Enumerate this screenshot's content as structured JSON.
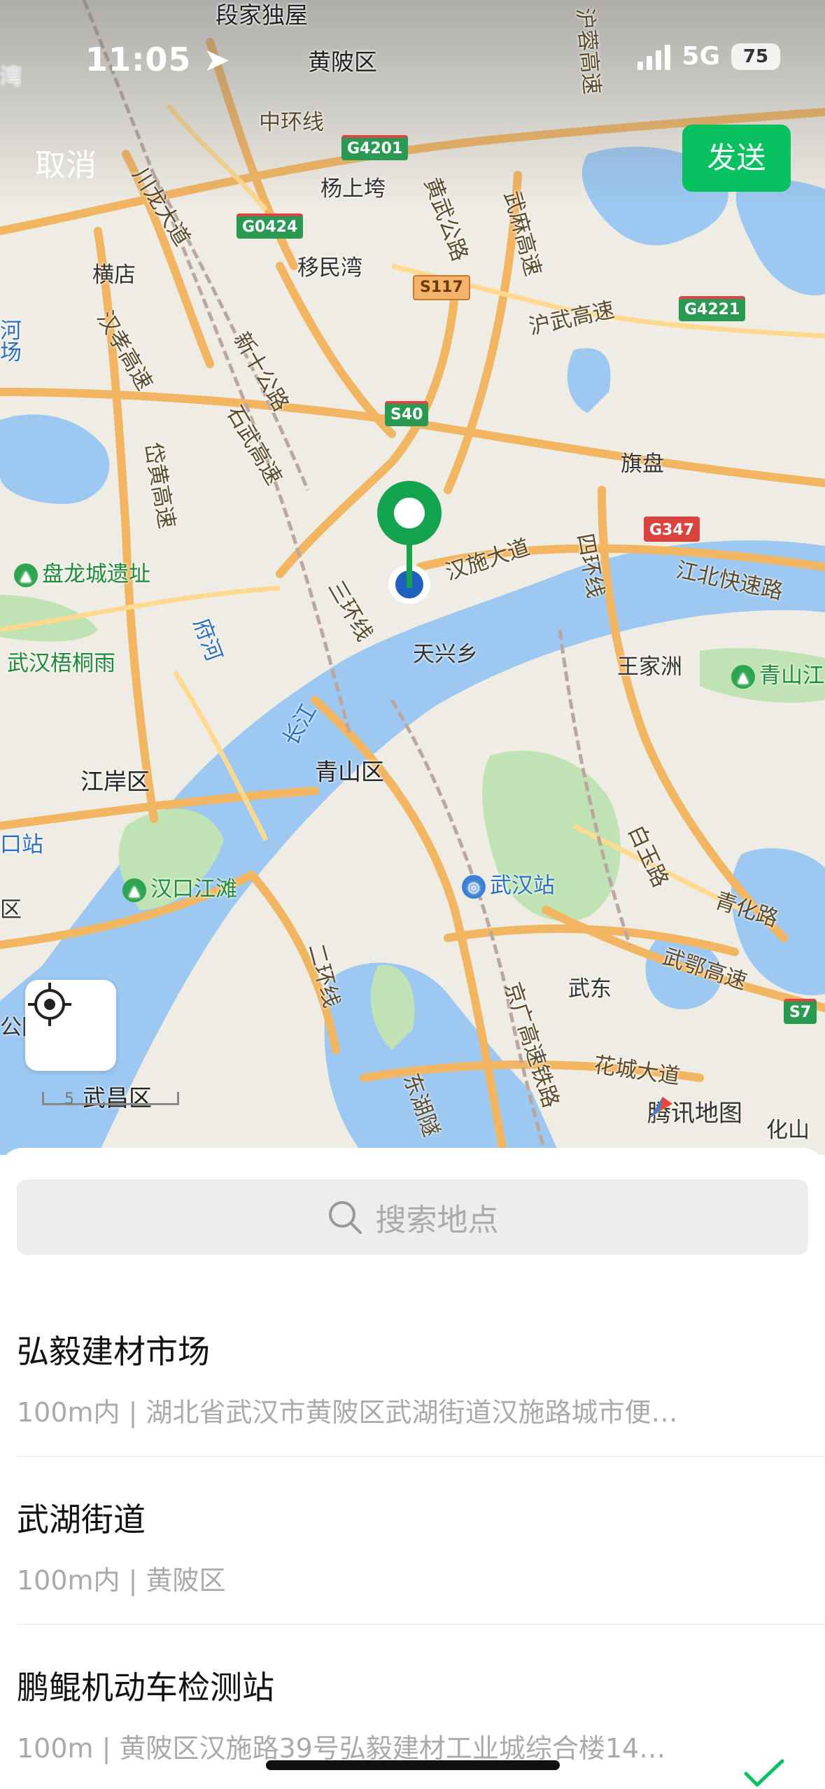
{
  "status_bar": {
    "time": "11:05",
    "network": "5G",
    "battery": "75"
  },
  "header": {
    "cancel_label": "取消",
    "send_label": "发送"
  },
  "map": {
    "districts": [
      "段家独屋",
      "黄陂区",
      "杨上垮",
      "移民湾",
      "横店",
      "天兴乡",
      "青山区",
      "江岸区",
      "武昌区",
      "旗盘",
      "王家洲",
      "武东"
    ],
    "road_labels": [
      "中环线",
      "川龙大道",
      "汉孝高速",
      "新十公路",
      "石武高速",
      "府河",
      "武麻高速",
      "沪武高速",
      "黄武公路",
      "汉施大道",
      "四环线",
      "江北快速路",
      "三环线",
      "二环线",
      "长江",
      "白玉路",
      "青化路",
      "武鄂高速",
      "京广高速铁路",
      "东湖隧",
      "花城大道",
      "岱黄高速",
      "沪蓉高速",
      "化山"
    ],
    "shields": [
      "G4201",
      "G0424",
      "S117",
      "G4221",
      "S40",
      "G347",
      "S7"
    ],
    "pois": [
      "盘龙城遗址",
      "武汉梧桐雨",
      "汉口江滩",
      "青山江",
      "武汉站"
    ],
    "edge_labels": [
      "河场",
      "口站",
      "区",
      "公园",
      "湾"
    ],
    "scale_text": "5",
    "brand": "腾讯地图"
  },
  "search": {
    "placeholder": "搜索地点"
  },
  "results": [
    {
      "title": "弘毅建材市场",
      "subtitle": "100m内 | 湖北省武汉市黄陂区武湖街道汉施路城市便…",
      "selected": false
    },
    {
      "title": "武湖街道",
      "subtitle": "100m内 | 黄陂区",
      "selected": false
    },
    {
      "title": "鹏鲲机动车检测站",
      "subtitle": "100m | 黄陂区汉施路39号弘毅建材工业城综合楼14…",
      "selected": true
    }
  ],
  "colors": {
    "accent": "#07c160",
    "pin": "#14a44d",
    "water": "#9cc8f2"
  }
}
